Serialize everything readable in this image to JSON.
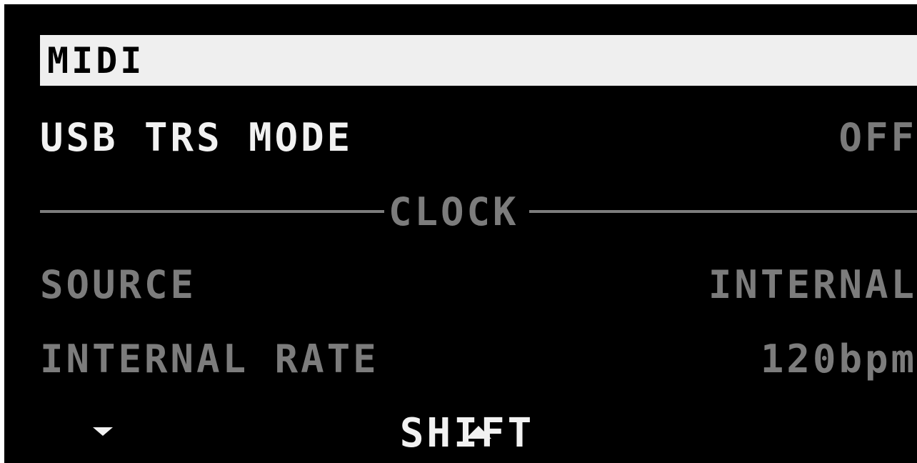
{
  "menu": {
    "title": "MIDI"
  },
  "settings": [
    {
      "label": "USB TRS MODE",
      "value": "OFF"
    }
  ],
  "clock_section": {
    "title": "CLOCK",
    "items": [
      {
        "label": "SOURCE",
        "value": "INTERNAL"
      },
      {
        "label": "INTERNAL RATE",
        "value": "120bpm"
      }
    ]
  },
  "softkeys": {
    "down_icon": "triangle-down",
    "up_icon": "triangle-up",
    "shift_label": "SHIFT",
    "left_icon": "triangle-left",
    "right_icon": "triangle-right"
  },
  "colors": {
    "background": "#000000",
    "highlight": "#efefef",
    "text_active": "#f2f2f2",
    "text_dim": "#7c7c7c"
  }
}
